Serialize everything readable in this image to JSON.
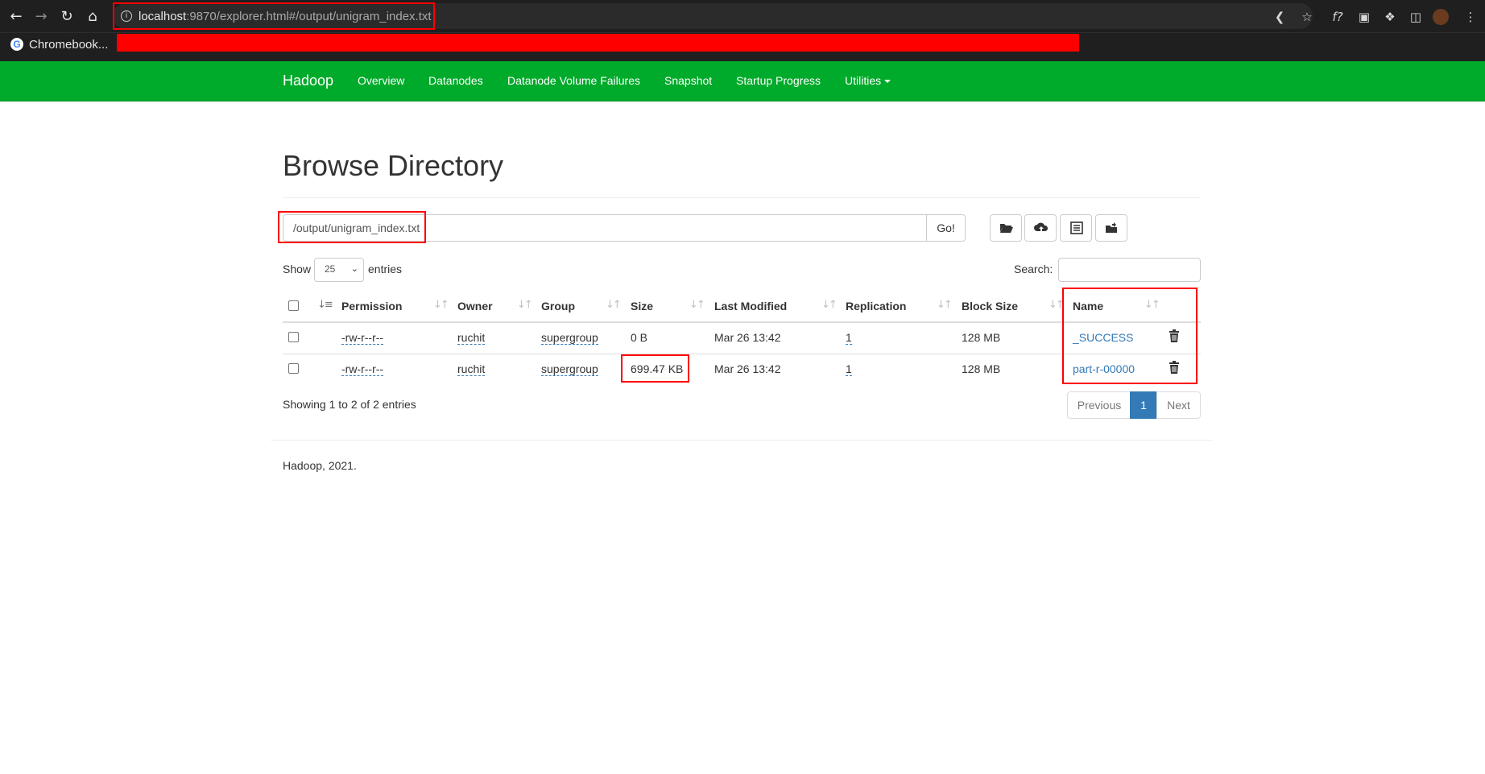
{
  "browser": {
    "url_host": "localhost",
    "url_rest": ":9870/explorer.html#/output/unigram_index.txt",
    "bookmark_label": "Chromebook..."
  },
  "navbar": {
    "brand": "Hadoop",
    "items": [
      "Overview",
      "Datanodes",
      "Datanode Volume Failures",
      "Snapshot",
      "Startup Progress",
      "Utilities"
    ]
  },
  "page": {
    "title": "Browse Directory",
    "path_value": "/output/unigram_index.txt",
    "go_label": "Go!",
    "show_label": "Show",
    "entries_value": "25",
    "entries_label": "entries",
    "search_label": "Search:"
  },
  "table": {
    "columns": [
      "Permission",
      "Owner",
      "Group",
      "Size",
      "Last Modified",
      "Replication",
      "Block Size",
      "Name"
    ],
    "rows": [
      {
        "permission": "-rw-r--r--",
        "owner": "ruchit",
        "group": "supergroup",
        "size": "0 B",
        "modified": "Mar 26 13:42",
        "replication": "1",
        "block_size": "128 MB",
        "name": "_SUCCESS"
      },
      {
        "permission": "-rw-r--r--",
        "owner": "ruchit",
        "group": "supergroup",
        "size": "699.47 KB",
        "modified": "Mar 26 13:42",
        "replication": "1",
        "block_size": "128 MB",
        "name": "part-r-00000"
      }
    ]
  },
  "pagination": {
    "showing": "Showing 1 to 2 of 2 entries",
    "previous": "Previous",
    "current": "1",
    "next": "Next"
  },
  "footer": "Hadoop, 2021.",
  "colors": {
    "navbar": "#00aa2a",
    "link": "#337ab7",
    "highlight": "#ff0000"
  }
}
